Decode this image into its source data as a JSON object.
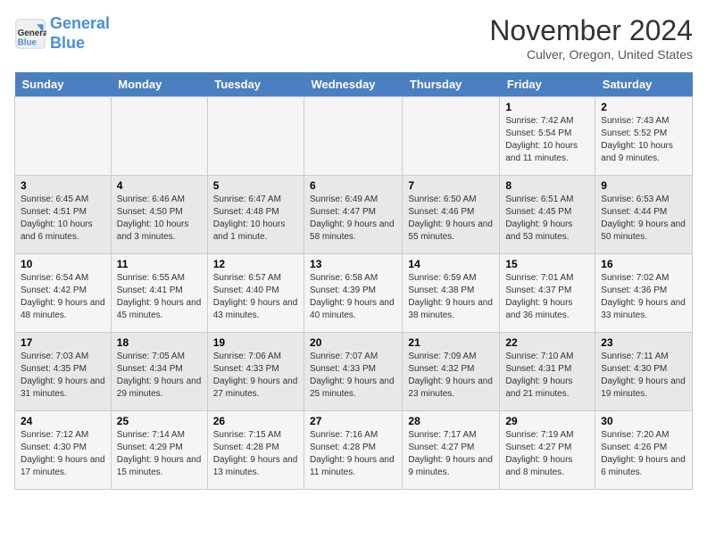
{
  "header": {
    "logo_line1": "General",
    "logo_line2": "Blue",
    "month": "November 2024",
    "location": "Culver, Oregon, United States"
  },
  "weekdays": [
    "Sunday",
    "Monday",
    "Tuesday",
    "Wednesday",
    "Thursday",
    "Friday",
    "Saturday"
  ],
  "weeks": [
    [
      {
        "day": "",
        "info": ""
      },
      {
        "day": "",
        "info": ""
      },
      {
        "day": "",
        "info": ""
      },
      {
        "day": "",
        "info": ""
      },
      {
        "day": "",
        "info": ""
      },
      {
        "day": "1",
        "info": "Sunrise: 7:42 AM\nSunset: 5:54 PM\nDaylight: 10 hours and 11 minutes."
      },
      {
        "day": "2",
        "info": "Sunrise: 7:43 AM\nSunset: 5:52 PM\nDaylight: 10 hours and 9 minutes."
      }
    ],
    [
      {
        "day": "3",
        "info": "Sunrise: 6:45 AM\nSunset: 4:51 PM\nDaylight: 10 hours and 6 minutes."
      },
      {
        "day": "4",
        "info": "Sunrise: 6:46 AM\nSunset: 4:50 PM\nDaylight: 10 hours and 3 minutes."
      },
      {
        "day": "5",
        "info": "Sunrise: 6:47 AM\nSunset: 4:48 PM\nDaylight: 10 hours and 1 minute."
      },
      {
        "day": "6",
        "info": "Sunrise: 6:49 AM\nSunset: 4:47 PM\nDaylight: 9 hours and 58 minutes."
      },
      {
        "day": "7",
        "info": "Sunrise: 6:50 AM\nSunset: 4:46 PM\nDaylight: 9 hours and 55 minutes."
      },
      {
        "day": "8",
        "info": "Sunrise: 6:51 AM\nSunset: 4:45 PM\nDaylight: 9 hours and 53 minutes."
      },
      {
        "day": "9",
        "info": "Sunrise: 6:53 AM\nSunset: 4:44 PM\nDaylight: 9 hours and 50 minutes."
      }
    ],
    [
      {
        "day": "10",
        "info": "Sunrise: 6:54 AM\nSunset: 4:42 PM\nDaylight: 9 hours and 48 minutes."
      },
      {
        "day": "11",
        "info": "Sunrise: 6:55 AM\nSunset: 4:41 PM\nDaylight: 9 hours and 45 minutes."
      },
      {
        "day": "12",
        "info": "Sunrise: 6:57 AM\nSunset: 4:40 PM\nDaylight: 9 hours and 43 minutes."
      },
      {
        "day": "13",
        "info": "Sunrise: 6:58 AM\nSunset: 4:39 PM\nDaylight: 9 hours and 40 minutes."
      },
      {
        "day": "14",
        "info": "Sunrise: 6:59 AM\nSunset: 4:38 PM\nDaylight: 9 hours and 38 minutes."
      },
      {
        "day": "15",
        "info": "Sunrise: 7:01 AM\nSunset: 4:37 PM\nDaylight: 9 hours and 36 minutes."
      },
      {
        "day": "16",
        "info": "Sunrise: 7:02 AM\nSunset: 4:36 PM\nDaylight: 9 hours and 33 minutes."
      }
    ],
    [
      {
        "day": "17",
        "info": "Sunrise: 7:03 AM\nSunset: 4:35 PM\nDaylight: 9 hours and 31 minutes."
      },
      {
        "day": "18",
        "info": "Sunrise: 7:05 AM\nSunset: 4:34 PM\nDaylight: 9 hours and 29 minutes."
      },
      {
        "day": "19",
        "info": "Sunrise: 7:06 AM\nSunset: 4:33 PM\nDaylight: 9 hours and 27 minutes."
      },
      {
        "day": "20",
        "info": "Sunrise: 7:07 AM\nSunset: 4:33 PM\nDaylight: 9 hours and 25 minutes."
      },
      {
        "day": "21",
        "info": "Sunrise: 7:09 AM\nSunset: 4:32 PM\nDaylight: 9 hours and 23 minutes."
      },
      {
        "day": "22",
        "info": "Sunrise: 7:10 AM\nSunset: 4:31 PM\nDaylight: 9 hours and 21 minutes."
      },
      {
        "day": "23",
        "info": "Sunrise: 7:11 AM\nSunset: 4:30 PM\nDaylight: 9 hours and 19 minutes."
      }
    ],
    [
      {
        "day": "24",
        "info": "Sunrise: 7:12 AM\nSunset: 4:30 PM\nDaylight: 9 hours and 17 minutes."
      },
      {
        "day": "25",
        "info": "Sunrise: 7:14 AM\nSunset: 4:29 PM\nDaylight: 9 hours and 15 minutes."
      },
      {
        "day": "26",
        "info": "Sunrise: 7:15 AM\nSunset: 4:28 PM\nDaylight: 9 hours and 13 minutes."
      },
      {
        "day": "27",
        "info": "Sunrise: 7:16 AM\nSunset: 4:28 PM\nDaylight: 9 hours and 11 minutes."
      },
      {
        "day": "28",
        "info": "Sunrise: 7:17 AM\nSunset: 4:27 PM\nDaylight: 9 hours and 9 minutes."
      },
      {
        "day": "29",
        "info": "Sunrise: 7:19 AM\nSunset: 4:27 PM\nDaylight: 9 hours and 8 minutes."
      },
      {
        "day": "30",
        "info": "Sunrise: 7:20 AM\nSunset: 4:26 PM\nDaylight: 9 hours and 6 minutes."
      }
    ]
  ]
}
